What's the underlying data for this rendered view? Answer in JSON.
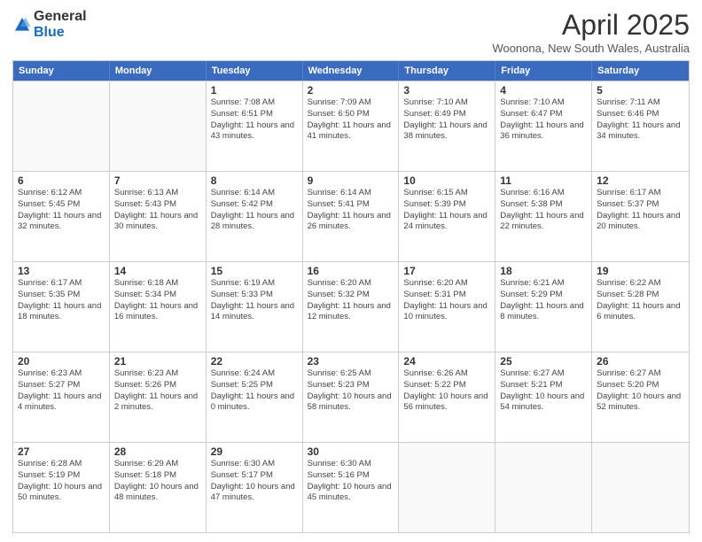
{
  "header": {
    "logo_general": "General",
    "logo_blue": "Blue",
    "month_title": "April 2025",
    "location": "Woonona, New South Wales, Australia"
  },
  "calendar": {
    "days_of_week": [
      "Sunday",
      "Monday",
      "Tuesday",
      "Wednesday",
      "Thursday",
      "Friday",
      "Saturday"
    ],
    "weeks": [
      [
        {
          "day": "",
          "info": ""
        },
        {
          "day": "",
          "info": ""
        },
        {
          "day": "1",
          "info": "Sunrise: 7:08 AM\nSunset: 6:51 PM\nDaylight: 11 hours and 43 minutes."
        },
        {
          "day": "2",
          "info": "Sunrise: 7:09 AM\nSunset: 6:50 PM\nDaylight: 11 hours and 41 minutes."
        },
        {
          "day": "3",
          "info": "Sunrise: 7:10 AM\nSunset: 6:49 PM\nDaylight: 11 hours and 38 minutes."
        },
        {
          "day": "4",
          "info": "Sunrise: 7:10 AM\nSunset: 6:47 PM\nDaylight: 11 hours and 36 minutes."
        },
        {
          "day": "5",
          "info": "Sunrise: 7:11 AM\nSunset: 6:46 PM\nDaylight: 11 hours and 34 minutes."
        }
      ],
      [
        {
          "day": "6",
          "info": "Sunrise: 6:12 AM\nSunset: 5:45 PM\nDaylight: 11 hours and 32 minutes."
        },
        {
          "day": "7",
          "info": "Sunrise: 6:13 AM\nSunset: 5:43 PM\nDaylight: 11 hours and 30 minutes."
        },
        {
          "day": "8",
          "info": "Sunrise: 6:14 AM\nSunset: 5:42 PM\nDaylight: 11 hours and 28 minutes."
        },
        {
          "day": "9",
          "info": "Sunrise: 6:14 AM\nSunset: 5:41 PM\nDaylight: 11 hours and 26 minutes."
        },
        {
          "day": "10",
          "info": "Sunrise: 6:15 AM\nSunset: 5:39 PM\nDaylight: 11 hours and 24 minutes."
        },
        {
          "day": "11",
          "info": "Sunrise: 6:16 AM\nSunset: 5:38 PM\nDaylight: 11 hours and 22 minutes."
        },
        {
          "day": "12",
          "info": "Sunrise: 6:17 AM\nSunset: 5:37 PM\nDaylight: 11 hours and 20 minutes."
        }
      ],
      [
        {
          "day": "13",
          "info": "Sunrise: 6:17 AM\nSunset: 5:35 PM\nDaylight: 11 hours and 18 minutes."
        },
        {
          "day": "14",
          "info": "Sunrise: 6:18 AM\nSunset: 5:34 PM\nDaylight: 11 hours and 16 minutes."
        },
        {
          "day": "15",
          "info": "Sunrise: 6:19 AM\nSunset: 5:33 PM\nDaylight: 11 hours and 14 minutes."
        },
        {
          "day": "16",
          "info": "Sunrise: 6:20 AM\nSunset: 5:32 PM\nDaylight: 11 hours and 12 minutes."
        },
        {
          "day": "17",
          "info": "Sunrise: 6:20 AM\nSunset: 5:31 PM\nDaylight: 11 hours and 10 minutes."
        },
        {
          "day": "18",
          "info": "Sunrise: 6:21 AM\nSunset: 5:29 PM\nDaylight: 11 hours and 8 minutes."
        },
        {
          "day": "19",
          "info": "Sunrise: 6:22 AM\nSunset: 5:28 PM\nDaylight: 11 hours and 6 minutes."
        }
      ],
      [
        {
          "day": "20",
          "info": "Sunrise: 6:23 AM\nSunset: 5:27 PM\nDaylight: 11 hours and 4 minutes."
        },
        {
          "day": "21",
          "info": "Sunrise: 6:23 AM\nSunset: 5:26 PM\nDaylight: 11 hours and 2 minutes."
        },
        {
          "day": "22",
          "info": "Sunrise: 6:24 AM\nSunset: 5:25 PM\nDaylight: 11 hours and 0 minutes."
        },
        {
          "day": "23",
          "info": "Sunrise: 6:25 AM\nSunset: 5:23 PM\nDaylight: 10 hours and 58 minutes."
        },
        {
          "day": "24",
          "info": "Sunrise: 6:26 AM\nSunset: 5:22 PM\nDaylight: 10 hours and 56 minutes."
        },
        {
          "day": "25",
          "info": "Sunrise: 6:27 AM\nSunset: 5:21 PM\nDaylight: 10 hours and 54 minutes."
        },
        {
          "day": "26",
          "info": "Sunrise: 6:27 AM\nSunset: 5:20 PM\nDaylight: 10 hours and 52 minutes."
        }
      ],
      [
        {
          "day": "27",
          "info": "Sunrise: 6:28 AM\nSunset: 5:19 PM\nDaylight: 10 hours and 50 minutes."
        },
        {
          "day": "28",
          "info": "Sunrise: 6:29 AM\nSunset: 5:18 PM\nDaylight: 10 hours and 48 minutes."
        },
        {
          "day": "29",
          "info": "Sunrise: 6:30 AM\nSunset: 5:17 PM\nDaylight: 10 hours and 47 minutes."
        },
        {
          "day": "30",
          "info": "Sunrise: 6:30 AM\nSunset: 5:16 PM\nDaylight: 10 hours and 45 minutes."
        },
        {
          "day": "",
          "info": ""
        },
        {
          "day": "",
          "info": ""
        },
        {
          "day": "",
          "info": ""
        }
      ]
    ]
  }
}
